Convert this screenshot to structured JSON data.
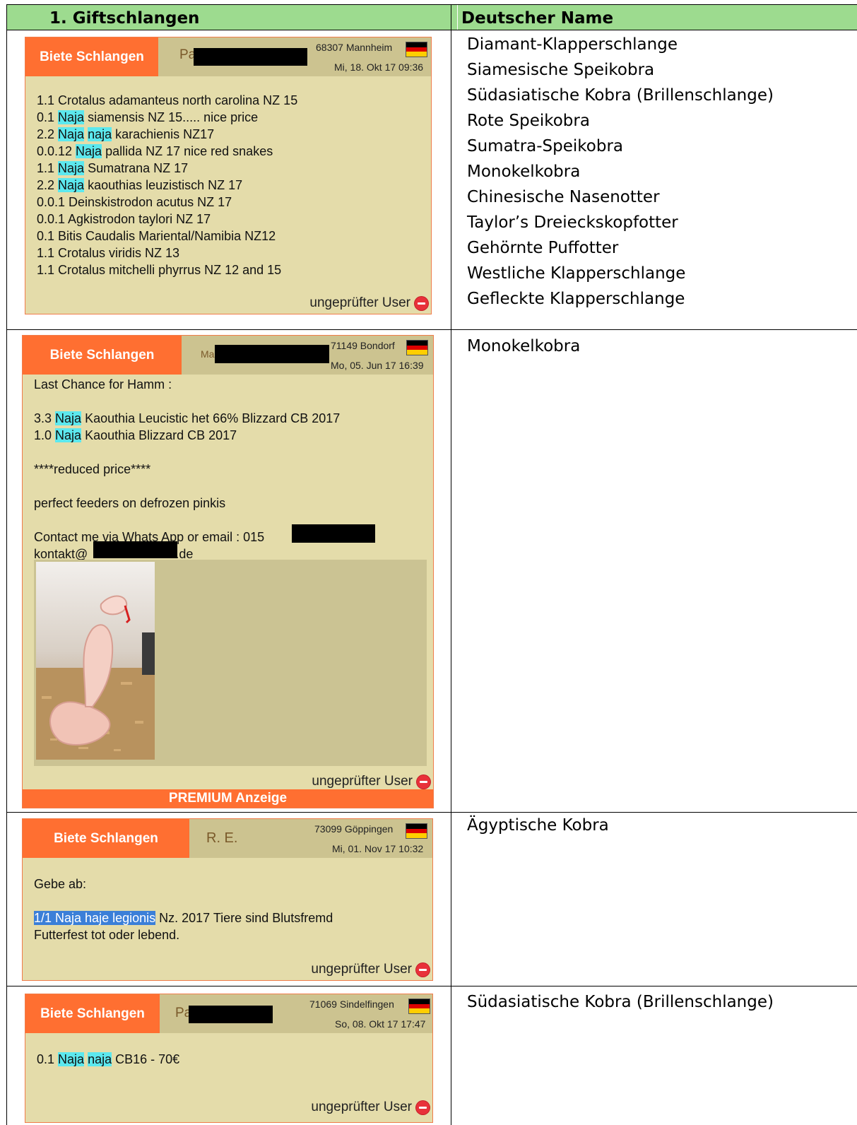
{
  "header": {
    "left": "1.   Giftschlangen",
    "right": "Deutscher Name"
  },
  "rows": [
    {
      "names": [
        "Diamant-Klapperschlange",
        "Siamesische Speikobra",
        "Südasiatische Kobra (Brillenschlange)",
        "Rote Speikobra",
        "Sumatra-Speikobra",
        "Monokelkobra",
        "Chinesische Nasenotter",
        "Taylor’s Dreieckskopfotter",
        "Gehörnte Puffotter",
        "Westliche Klapperschlange",
        "Gefleckte Klapperschlange"
      ],
      "ad": {
        "category": "Biete Schlangen",
        "user_prefix": "Pa",
        "location": "68307 Mannheim",
        "date": "Mi, 18. Okt 17 09:36",
        "lines": [
          [
            "1.1 Crotalus adamanteus north carolina NZ 15"
          ],
          [
            "0.1 ",
            "Naja",
            " siamensis NZ 15..... nice price"
          ],
          [
            "2.2 ",
            "Naja",
            " ",
            "naja",
            " karachienis NZ17"
          ],
          [
            "0.0.12 ",
            "Naja",
            " pallida NZ 17 nice red snakes"
          ],
          [
            "1.1 ",
            "Naja",
            " Sumatrana NZ 17"
          ],
          [
            "2.2 ",
            "Naja",
            " kaouthias leuzistisch NZ 17"
          ],
          [
            "0.0.1 Deinskistrodon acutus NZ 17"
          ],
          [
            "0.0.1 Agkistrodon taylori NZ 17"
          ],
          [
            "0.1 Bitis Caudalis Mariental/Namibia NZ12"
          ],
          [
            "1.1 Crotalus viridis NZ 13"
          ],
          [
            "1.1 Crotalus mitchelli phyrrus NZ 12 and 15"
          ]
        ],
        "footer": "ungeprüfter User"
      }
    },
    {
      "names": [
        "Monokelkobra"
      ],
      "ad": {
        "category": "Biete Schlangen",
        "user_prefix": "Ma",
        "location": "71149 Bondorf",
        "date": "Mo, 05. Jun 17 16:39",
        "lines": [
          [
            "Last Chance for Hamm :"
          ],
          [
            ""
          ],
          [
            "3.3 ",
            "Naja",
            " Kaouthia Leucistic het 66% Blizzard CB 2017"
          ],
          [
            "1.0 ",
            "Naja",
            " Kaouthia Blizzard CB 2017"
          ],
          [
            ""
          ],
          [
            "****reduced price****"
          ],
          [
            ""
          ],
          [
            "perfect feeders on defrozen pinkis"
          ],
          [
            ""
          ],
          [
            "Contact me via Whats App or email : 015"
          ],
          [
            "kontakt@",
            "r.de"
          ]
        ],
        "footer": "ungeprüfter User",
        "premium": "PREMIUM Anzeige"
      }
    },
    {
      "names": [
        "Ägyptische Kobra"
      ],
      "ad": {
        "category": "Biete Schlangen",
        "user_prefix": "R. E.",
        "location": "73099 Göppingen",
        "date": "Mi, 01. Nov 17 10:32",
        "lines": [
          [
            "Gebe ab:"
          ],
          [
            ""
          ],
          [
            "1/1 Naja haje legionis",
            " Nz. 2017 Tiere sind Blutsfremd"
          ],
          [
            "Futterfest tot oder lebend."
          ]
        ],
        "footer": "ungeprüfter User"
      }
    },
    {
      "names": [
        "Südasiatische Kobra (Brillenschlange)"
      ],
      "ad": {
        "category": "Biete Schlangen",
        "user_prefix": "Pa",
        "location": "71069 Sindelfingen",
        "date": "So, 08. Okt 17 17:47",
        "lines": [
          [
            "0.1 ",
            "Naja",
            " ",
            "naja",
            " CB16 - 70€"
          ]
        ],
        "footer": "ungeprüfter User"
      }
    }
  ],
  "colors": {
    "header_green": "#9ddb8f",
    "ad_orange": "#ff6f31",
    "card_bg": "#e4dcaa",
    "card_head": "#ccc390",
    "highlight": "#5ce8ee",
    "selection": "#3b7fd8"
  },
  "icons": {
    "flag": "germany-flag-icon",
    "status": "no-entry-icon"
  }
}
